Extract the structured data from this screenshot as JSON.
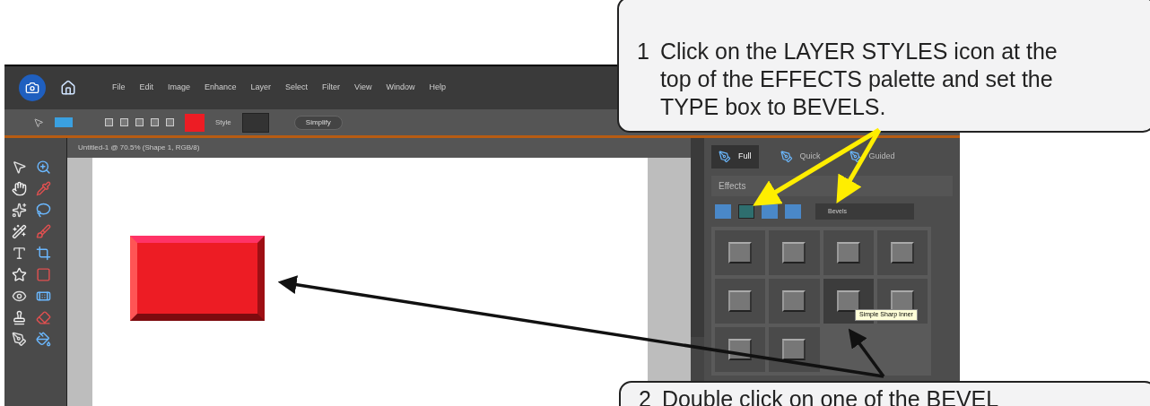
{
  "menu_bar": {
    "items": [
      "File",
      "Edit",
      "Image",
      "Enhance",
      "Layer",
      "Select",
      "Filter",
      "View",
      "Window",
      "Help"
    ]
  },
  "options_bar": {
    "style_label": "Style",
    "simplify_button": "Simplify"
  },
  "document": {
    "title": "Untitled-1 @ 70.5% (Shape 1, RGB/8)"
  },
  "panel": {
    "tabs": [
      {
        "label": "Full",
        "selected": true
      },
      {
        "label": "Quick",
        "selected": false
      },
      {
        "label": "Guided",
        "selected": false
      }
    ],
    "section_title": "Effects",
    "effect_types": [
      {
        "selected": false
      },
      {
        "selected": true
      },
      {
        "selected": false
      },
      {
        "selected": false
      }
    ],
    "type_dropdown": "Bevels",
    "thumbnails": [
      {
        "selected": false
      },
      {
        "selected": false
      },
      {
        "selected": false
      },
      {
        "selected": false
      },
      {
        "selected": false
      },
      {
        "selected": false
      },
      {
        "selected": true
      },
      {
        "selected": false
      },
      {
        "selected": false
      },
      {
        "selected": false
      }
    ],
    "tooltip": "Simple Sharp Inner"
  },
  "callouts": [
    {
      "number": "1",
      "text": "Click on the LAYER STYLES icon at the top of the EFFECTS palette and set the TYPE box to BEVELS."
    },
    {
      "number": "2",
      "text": "Double click on one of the BEVEL"
    }
  ]
}
